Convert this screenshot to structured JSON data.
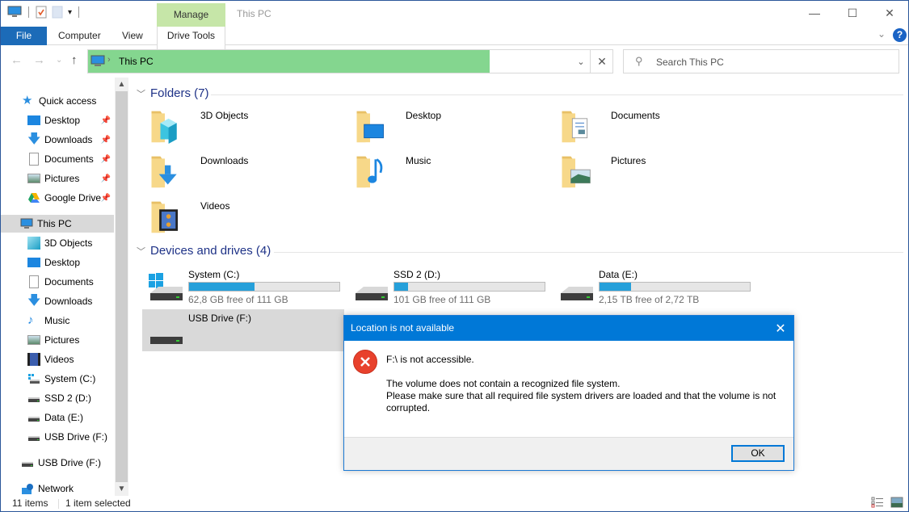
{
  "window": {
    "title": "This PC",
    "contextual_tab_group": "Manage",
    "controls": {
      "minimize": "—",
      "maximize": "☐",
      "close": "✕"
    }
  },
  "quick_access_toolbar": {
    "icons": [
      "computer-icon",
      "properties-icon",
      "new-folder-icon",
      "customize-dropdown-icon"
    ]
  },
  "ribbon": {
    "tabs": [
      {
        "label": "File",
        "active": true
      },
      {
        "label": "Computer"
      },
      {
        "label": "View"
      },
      {
        "label": "Drive Tools"
      }
    ],
    "collapse_glyph": "⌄",
    "help_glyph": "?"
  },
  "navigation": {
    "back": "←",
    "forward": "→",
    "recent": "⌄",
    "up": "↑",
    "address": {
      "breadcrumb": [
        "This PC"
      ],
      "dropdown": "⌄",
      "clear": "✕",
      "highlight_color": "#84d68f"
    },
    "search": {
      "placeholder": "Search This PC",
      "icon": "⚲"
    }
  },
  "nav_pane": {
    "items": [
      {
        "label": "Quick access",
        "icon": "star-icon",
        "level": 0
      },
      {
        "label": "Desktop",
        "icon": "desktop-icon",
        "level": 1,
        "pinned": true
      },
      {
        "label": "Downloads",
        "icon": "downloads-icon",
        "level": 1,
        "pinned": true
      },
      {
        "label": "Documents",
        "icon": "documents-icon",
        "level": 1,
        "pinned": true
      },
      {
        "label": "Pictures",
        "icon": "pictures-icon",
        "level": 1,
        "pinned": true
      },
      {
        "label": "Google Drive",
        "icon": "google-drive-icon",
        "level": 1,
        "pinned": true
      },
      {
        "label": "This PC",
        "icon": "computer-icon",
        "level": 0,
        "selected": true
      },
      {
        "label": "3D Objects",
        "icon": "3d-objects-icon",
        "level": 1
      },
      {
        "label": "Desktop",
        "icon": "desktop-icon",
        "level": 1
      },
      {
        "label": "Documents",
        "icon": "documents-icon",
        "level": 1
      },
      {
        "label": "Downloads",
        "icon": "downloads-icon",
        "level": 1
      },
      {
        "label": "Music",
        "icon": "music-icon",
        "level": 1
      },
      {
        "label": "Pictures",
        "icon": "pictures-icon",
        "level": 1
      },
      {
        "label": "Videos",
        "icon": "videos-icon",
        "level": 1
      },
      {
        "label": "System (C:)",
        "icon": "system-drive-icon",
        "level": 1
      },
      {
        "label": "SSD 2 (D:)",
        "icon": "drive-icon",
        "level": 1
      },
      {
        "label": "Data (E:)",
        "icon": "drive-icon",
        "level": 1
      },
      {
        "label": "USB Drive (F:)",
        "icon": "drive-icon",
        "level": 1
      },
      {
        "label": "USB Drive (F:)",
        "icon": "drive-icon",
        "level": 0
      },
      {
        "label": "Network",
        "icon": "network-icon",
        "level": 0
      }
    ]
  },
  "content": {
    "folders_group": {
      "title": "Folders (7)",
      "items": [
        {
          "label": "3D Objects",
          "overlay": "3d-objects"
        },
        {
          "label": "Desktop",
          "overlay": "desktop"
        },
        {
          "label": "Documents",
          "overlay": "documents"
        },
        {
          "label": "Downloads",
          "overlay": "downloads"
        },
        {
          "label": "Music",
          "overlay": "music"
        },
        {
          "label": "Pictures",
          "overlay": "pictures"
        },
        {
          "label": "Videos",
          "overlay": "videos"
        }
      ]
    },
    "drives_group": {
      "title": "Devices and drives (4)",
      "items": [
        {
          "label": "System (C:)",
          "free_text": "62,8 GB free of 111 GB",
          "used_fraction": 0.434,
          "system": true
        },
        {
          "label": "SSD 2 (D:)",
          "free_text": "101 GB free of 111 GB",
          "used_fraction": 0.09
        },
        {
          "label": "Data (E:)",
          "free_text": "2,15 TB free of 2,72 TB",
          "used_fraction": 0.21
        },
        {
          "label": "USB Drive (F:)",
          "free_text": "",
          "used_fraction": null,
          "selected": true
        }
      ]
    }
  },
  "status_bar": {
    "items_count": "11 items",
    "selection": "1 item selected"
  },
  "dialog": {
    "title": "Location is not available",
    "close": "✕",
    "headline": "F:\\ is not accessible.",
    "body_line1": "The volume does not contain a recognized file system.",
    "body_line2": "Please make sure that all required file system drivers are loaded and that the volume is not corrupted.",
    "ok_label": "OK",
    "accent": "#0078d7",
    "error_color": "#e8412c"
  }
}
